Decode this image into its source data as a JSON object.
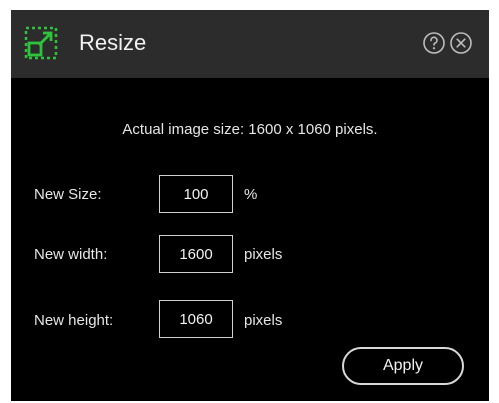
{
  "dialog": {
    "title": "Resize",
    "icon": "resize-icon",
    "help_icon": "help-icon",
    "close_icon": "close-icon"
  },
  "info_text": "Actual image size: 1600 x 1060 pixels.",
  "fields": {
    "size": {
      "label": "New Size:",
      "value": "100",
      "unit": "%"
    },
    "width": {
      "label": "New width:",
      "value": "1600",
      "unit": "pixels"
    },
    "height": {
      "label": "New height:",
      "value": "1060",
      "unit": "pixels"
    }
  },
  "apply_label": "Apply",
  "colors": {
    "accent": "#2fc23d",
    "titlebar": "#2c2c2c",
    "background": "#000000"
  }
}
